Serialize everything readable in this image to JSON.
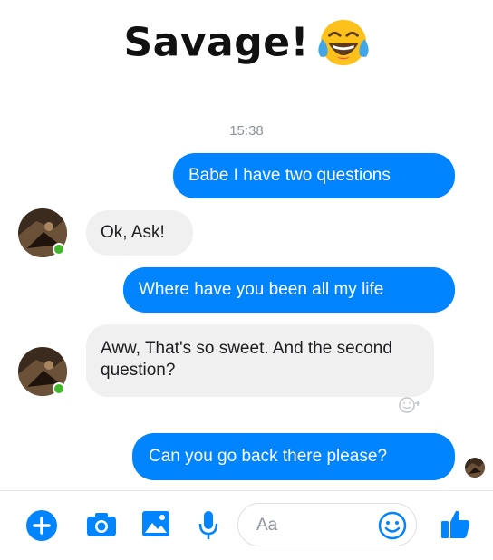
{
  "caption": {
    "text": "Savage!",
    "emoji": "tears-of-joy-emoji"
  },
  "conversation": {
    "timestamp": "15:38",
    "messages": [
      {
        "direction": "outgoing",
        "text": "Babe I have two questions"
      },
      {
        "direction": "incoming",
        "text": "Ok, Ask!"
      },
      {
        "direction": "outgoing",
        "text": "Where have you been all my life"
      },
      {
        "direction": "incoming",
        "text": "Aww, That's so sweet. And the second question?"
      },
      {
        "direction": "outgoing",
        "text": "Can you go back there please?"
      }
    ],
    "contact": {
      "online": true,
      "avatar": "contact-avatar"
    },
    "reaction_icon": "add-reaction-icon",
    "seen_indicator": "seen-avatar"
  },
  "composer": {
    "placeholder": "Aa",
    "icons": [
      "plus-icon",
      "camera-icon",
      "photo-icon",
      "microphone-icon",
      "emoji-icon",
      "thumbs-up-icon"
    ]
  },
  "colors": {
    "outgoing_bubble": "#0084ff",
    "incoming_bubble": "#f1f0f0",
    "accent": "#0084ff",
    "online": "#42b72a"
  }
}
